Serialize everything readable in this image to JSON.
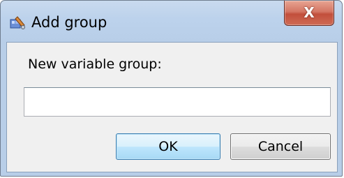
{
  "window": {
    "title": "Add group",
    "close_label": "X",
    "app_icon": "app-wrench-icon"
  },
  "form": {
    "label": "New variable group:",
    "input_value": "",
    "input_placeholder": ""
  },
  "buttons": {
    "ok_label": "OK",
    "cancel_label": "Cancel"
  },
  "colors": {
    "titlebar": "#bcd2ec",
    "close_button": "#c24f3c",
    "ok_button_border": "#3c7fb1",
    "client_bg": "#f0f0f0"
  }
}
